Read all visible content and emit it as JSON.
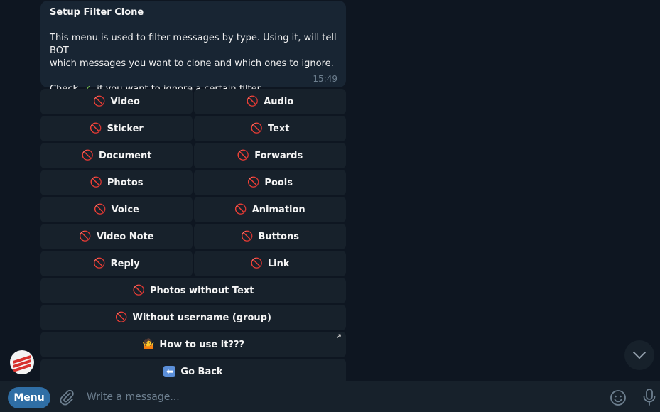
{
  "message": {
    "title": "Setup Filter Clone",
    "body_line1": "This menu is used to filter messages by type. Using it, will tell BOT",
    "body_line2": "which messages you want to clone and which ones to ignore.",
    "check_before": "Check",
    "check_icon": "✓",
    "check_after": "if you want to ignore a certain filter.",
    "time": "15:49"
  },
  "keyboard": {
    "rows": [
      [
        "Video",
        "Audio"
      ],
      [
        "Sticker",
        "Text"
      ],
      [
        "Document",
        "Forwards"
      ],
      [
        "Photos",
        "Pools"
      ],
      [
        "Voice",
        "Animation"
      ],
      [
        "Video Note",
        "Buttons"
      ],
      [
        "Reply",
        "Link"
      ],
      [
        "Photos without Text"
      ],
      [
        "Without username (group)"
      ]
    ],
    "disabled_icon": "🚫",
    "how_to_use": "How to use it???",
    "how_to_use_icon": "🤷",
    "go_back": "Go Back",
    "go_back_icon": "⬅",
    "link_arrow": "↗"
  },
  "composer": {
    "menu_label": "Menu",
    "placeholder": "Write a message..."
  },
  "icons": {
    "avatar": "bot-avatar",
    "scroll": "chevron-down-icon",
    "attach": "paperclip-icon",
    "emoji": "emoji-icon",
    "mic": "microphone-icon"
  },
  "colors": {
    "background": "#0e1621",
    "bubble": "#182533",
    "button": "#17212b",
    "accent": "#2f6ea5",
    "disabled_icon": "#e0453a"
  }
}
